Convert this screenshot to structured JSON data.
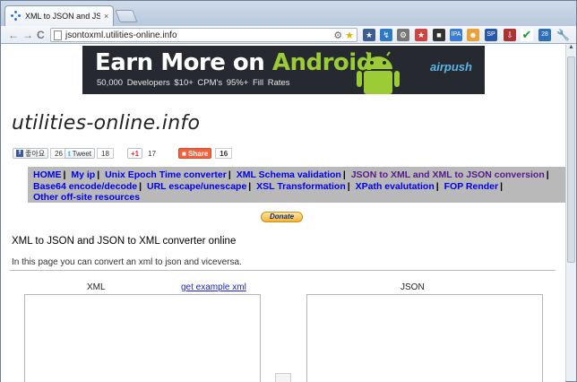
{
  "browser": {
    "tab_title": "XML to JSON and JSON to XML",
    "tab_close": "×",
    "back": "←",
    "forward": "→",
    "reload": "C",
    "url": "jsontoxml.utilities-online.info",
    "menu_icon": "wrench-icon"
  },
  "banner": {
    "title_part1": "Earn More on ",
    "title_part2": "Android",
    "subtitle": "50,000 Developers   $10+ CPM's   95%+ Fill Rates",
    "brand": "airpush",
    "colors": {
      "background": "#262a30",
      "accent": "#9bcb35"
    }
  },
  "site": {
    "title": "utilities-online.info"
  },
  "social": {
    "facebook_label": "좋아요",
    "facebook_count": "26",
    "tweet_label": "Tweet",
    "tweet_count": "18",
    "gplus_label": "+1",
    "gplus_count": "17",
    "share_label": "Share",
    "share_count": "16"
  },
  "nav": {
    "items": [
      "HOME",
      "My ip",
      "Unix Epoch Time converter",
      "XML Schema validation",
      "JSON to XML and XML to JSON conversion",
      "Base64 encode/decode",
      "URL escape/unescape",
      "XSL Transformation",
      "XPath evalutation",
      "FOP Render",
      "Other off-site resources"
    ],
    "separator": "|"
  },
  "donate_label": "Donate",
  "main": {
    "heading": "XML to JSON and JSON to XML converter online",
    "intro": "In this page you can convert an xml to json and viceversa.",
    "xml_label": "XML",
    "example_link": "get example xml",
    "json_label": "JSON"
  }
}
